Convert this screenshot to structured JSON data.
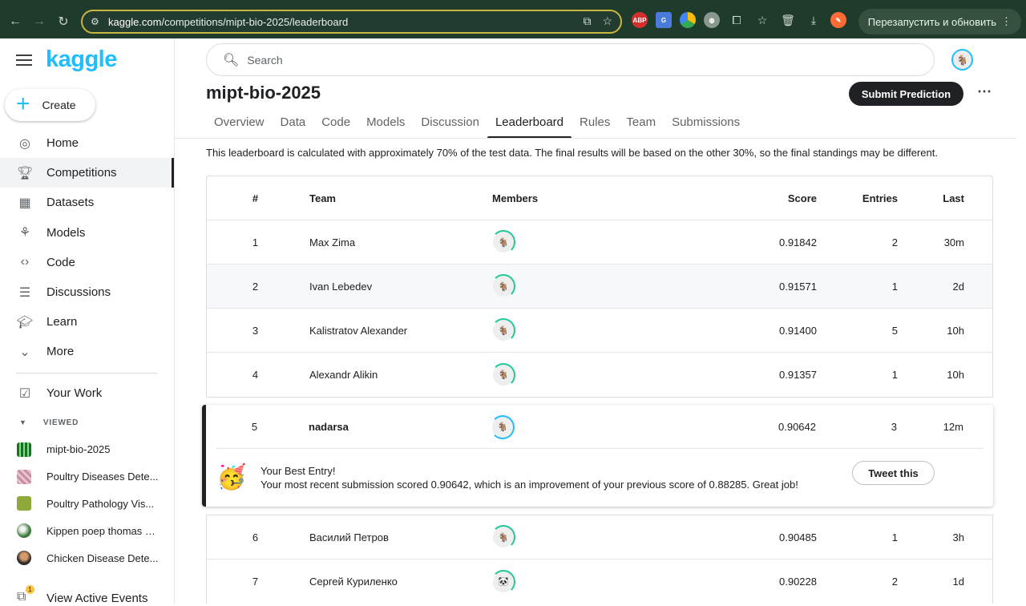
{
  "browser": {
    "url_host": "kaggle.com",
    "url_path": "/competitions/mipt-bio-2025/leaderboard",
    "restart_label": "Перезапустить и обновить",
    "ext_abp": "ABP"
  },
  "sidebar": {
    "logo": "kaggle",
    "create_label": "Create",
    "items": [
      {
        "label": "Home",
        "icon": "compass-icon"
      },
      {
        "label": "Competitions",
        "icon": "trophy-icon"
      },
      {
        "label": "Datasets",
        "icon": "table-icon"
      },
      {
        "label": "Models",
        "icon": "models-icon"
      },
      {
        "label": "Code",
        "icon": "code-icon"
      },
      {
        "label": "Discussions",
        "icon": "chat-icon"
      },
      {
        "label": "Learn",
        "icon": "graduation-cap-icon"
      },
      {
        "label": "More",
        "icon": "chevron-down-icon"
      }
    ],
    "your_work": "Your Work",
    "viewed_header": "VIEWED",
    "viewed": [
      {
        "label": "mipt-bio-2025"
      },
      {
        "label": "Poultry Diseases Dete..."
      },
      {
        "label": "Poultry Pathology Vis..."
      },
      {
        "label": "Kippen poep thomas b..."
      },
      {
        "label": "Chicken Disease Dete..."
      }
    ],
    "events_label": "View Active Events",
    "events_badge": "1"
  },
  "header": {
    "search_placeholder": "Search",
    "title": "mipt-bio-2025",
    "submit_label": "Submit Prediction",
    "kebab": "⋯"
  },
  "tabs": [
    "Overview",
    "Data",
    "Code",
    "Models",
    "Discussion",
    "Leaderboard",
    "Rules",
    "Team",
    "Submissions"
  ],
  "notice": "This leaderboard is calculated with approximately 70% of the test data. The final results will be based on the other 30%, so the final standings may be different.",
  "leaderboard": {
    "columns": {
      "rank": "#",
      "team": "Team",
      "members": "Members",
      "score": "Score",
      "entries": "Entries",
      "last": "Last"
    },
    "rows": [
      {
        "rank": "1",
        "team": "Max Zima",
        "score": "0.91842",
        "entries": "2",
        "last": "30m"
      },
      {
        "rank": "2",
        "team": "Ivan Lebedev",
        "score": "0.91571",
        "entries": "1",
        "last": "2d"
      },
      {
        "rank": "3",
        "team": "Kalistratov Alexander",
        "score": "0.91400",
        "entries": "5",
        "last": "10h"
      },
      {
        "rank": "4",
        "team": "Alexandr Alikin",
        "score": "0.91357",
        "entries": "1",
        "last": "10h"
      }
    ],
    "mine": {
      "rank": "5",
      "team": "nadarsa",
      "score": "0.90642",
      "entries": "3",
      "last": "12m"
    },
    "best_entry": {
      "emoji": "🥳",
      "title": "Your Best Entry!",
      "message": "Your most recent submission scored 0.90642, which is an improvement of your previous score of 0.88285. Great job!",
      "tweet_label": "Tweet this"
    },
    "rows_after": [
      {
        "rank": "6",
        "team": "Василий Петров",
        "score": "0.90485",
        "entries": "1",
        "last": "3h"
      },
      {
        "rank": "7",
        "team": "Сергей Куриленко",
        "score": "0.90228",
        "entries": "2",
        "last": "1d"
      }
    ]
  }
}
